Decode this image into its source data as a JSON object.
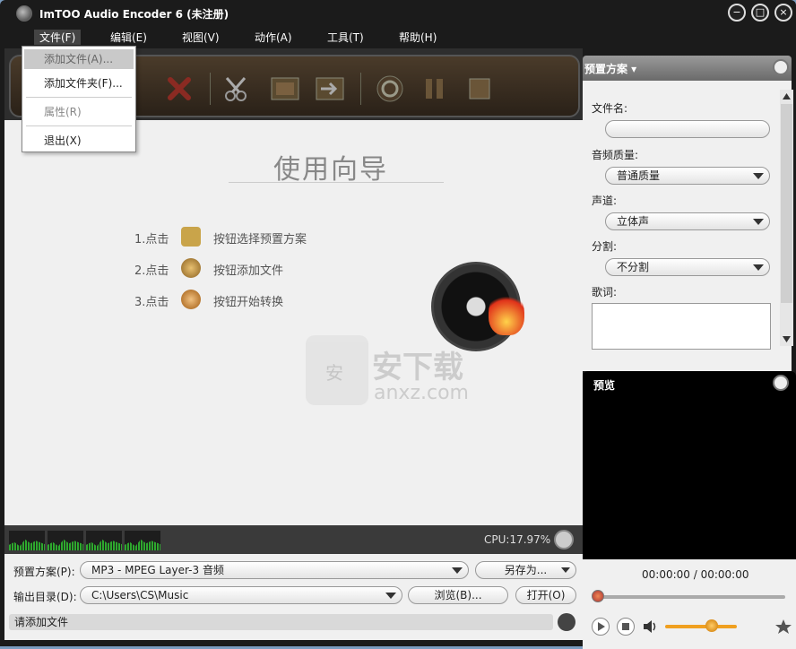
{
  "window": {
    "title": "ImTOO Audio Encoder 6 (未注册)",
    "minimize_glyph": "−",
    "maximize_glyph": "□",
    "close_glyph": "×"
  },
  "menubar": {
    "items": [
      {
        "label": "文件(F)"
      },
      {
        "label": "编辑(E)"
      },
      {
        "label": "视图(V)"
      },
      {
        "label": "动作(A)"
      },
      {
        "label": "工具(T)"
      },
      {
        "label": "帮助(H)"
      }
    ]
  },
  "file_menu": {
    "items": [
      {
        "label": "添加文件(A)..."
      },
      {
        "label": "添加文件夹(F)..."
      },
      {
        "label": "属性(R)"
      },
      {
        "label": "退出(X)"
      }
    ]
  },
  "wizard": {
    "title": "使用向导",
    "steps": [
      {
        "prefix": "1.点击",
        "text": "按钮选择预置方案"
      },
      {
        "prefix": "2.点击",
        "text": "按钮添加文件"
      },
      {
        "prefix": "3.点击",
        "text": "按钮开始转换"
      }
    ]
  },
  "watermark": {
    "text": "安下载",
    "sub": "anxz.com",
    "bag_glyph": "安"
  },
  "status": {
    "cpu": "CPU:17.97%",
    "message": "请添加文件"
  },
  "bottom_form": {
    "profile_label": "预置方案(P):",
    "profile_value": "MP3 - MPEG Layer-3 音频",
    "save_as_label": "另存为...",
    "output_label": "输出目录(D):",
    "output_value": "C:\\Users\\CS\\Music",
    "browse_label": "浏览(B)...",
    "open_label": "打开(O)"
  },
  "profile_panel": {
    "header": "预置方案 ▾",
    "filename_label": "文件名:",
    "filename_value": "",
    "quality_label": "音频质量:",
    "quality_value": "普通质量",
    "channel_label": "声道:",
    "channel_value": "立体声",
    "split_label": "分割:",
    "split_value": "不分割",
    "lyrics_label": "歌词:",
    "lyrics_value": ""
  },
  "preview": {
    "label": "预览",
    "time": "00:00:00 / 00:00:00",
    "volume_level": 0.65
  },
  "colors": {
    "volume": "#f0a020",
    "visualizer": "#2ea82e"
  }
}
